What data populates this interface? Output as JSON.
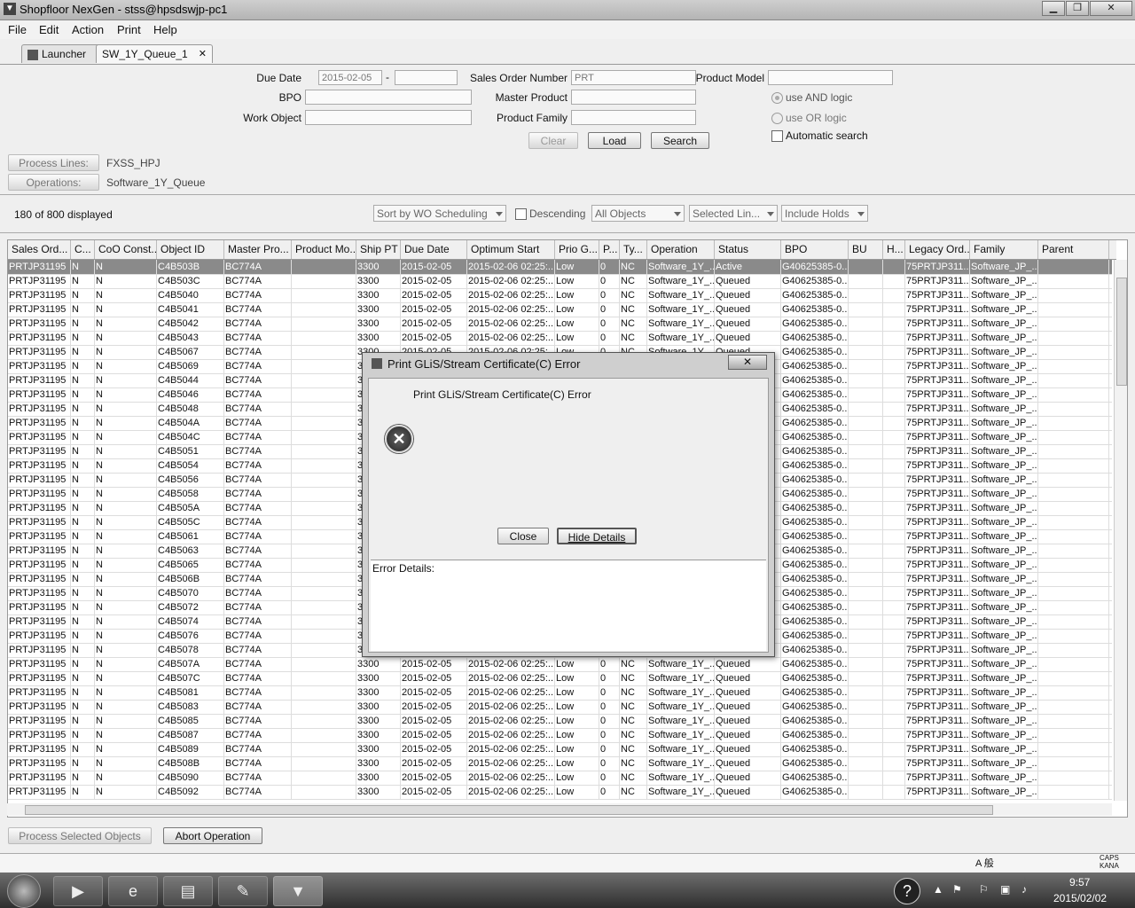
{
  "window": {
    "title": "Shopfloor NexGen - stss@hpsdswjp-pc1"
  },
  "menu": [
    "File",
    "Edit",
    "Action",
    "Print",
    "Help"
  ],
  "tabs": [
    {
      "label": "Launcher"
    },
    {
      "label": "SW_1Y_Queue_1",
      "close": "✕"
    }
  ],
  "search": {
    "due_date_label": "Due Date",
    "due_date_from": "2015-02-05",
    "due_date_sep": "-",
    "due_date_to": "",
    "bpo_label": "BPO",
    "bpo_value": "",
    "work_object_label": "Work Object",
    "work_object_value": "",
    "sales_order_label": "Sales Order Number",
    "sales_order_value": "PRT",
    "master_product_label": "Master Product",
    "master_product_value": "",
    "product_family_label": "Product Family",
    "product_family_value": "",
    "product_model_label": "Product Model",
    "product_model_value": "",
    "and_logic": "use AND logic",
    "or_logic": "use OR logic",
    "auto_search": "Automatic search",
    "clear": "Clear",
    "load": "Load",
    "search": "Search"
  },
  "process_lines": {
    "button": "Process Lines:",
    "value": "FXSS_HPJ"
  },
  "operations": {
    "button": "Operations:",
    "value": "Software_1Y_Queue"
  },
  "list_toolbar": {
    "count": "180 of 800 displayed",
    "sort": "Sort by WO Scheduling",
    "descending": "Descending",
    "objects": "All Objects",
    "lines": "Selected Lin...",
    "holds": "Include Holds"
  },
  "table": {
    "columns": [
      "Sales Ord...",
      "C...",
      "CoO Const...",
      "Object ID",
      "Master Pro...",
      "Product Mo...",
      "Ship PT",
      "Due Date",
      "Optimum Start",
      "Prio G...",
      "P...",
      "Ty...",
      "Operation",
      "Status",
      "BPO",
      "BU",
      "H...",
      "Legacy Ord...",
      "Family",
      "Parent"
    ],
    "common": {
      "sales_order": "PRTJP31195",
      "c": "N",
      "coo": "N",
      "master": "BC774A",
      "ship_pt": "3300",
      "due_date": "2015-02-05",
      "optimum": "2015-02-06 02:25:...",
      "prio": "Low",
      "p": "0",
      "type": "NC",
      "operation": "Software_1Y_...",
      "bpo": "G40625385-0...",
      "legacy": "75PRTJP311...",
      "family": "Software_JP_..."
    },
    "rows": [
      {
        "object_id": "C4B503B",
        "status": "Active"
      },
      {
        "object_id": "C4B503C",
        "status": "Queued"
      },
      {
        "object_id": "C4B5040",
        "status": "Queued"
      },
      {
        "object_id": "C4B5041",
        "status": "Queued"
      },
      {
        "object_id": "C4B5042",
        "status": "Queued"
      },
      {
        "object_id": "C4B5043",
        "status": "Queued"
      },
      {
        "object_id": "C4B5067",
        "status": "Queued"
      },
      {
        "object_id": "C4B5069",
        "status": "Queued"
      },
      {
        "object_id": "C4B5044",
        "status": "Queued"
      },
      {
        "object_id": "C4B5046",
        "status": "Queued"
      },
      {
        "object_id": "C4B5048",
        "status": "Queued"
      },
      {
        "object_id": "C4B504A",
        "status": "Queued"
      },
      {
        "object_id": "C4B504C",
        "status": "Queued"
      },
      {
        "object_id": "C4B5051",
        "status": "Queued"
      },
      {
        "object_id": "C4B5054",
        "status": "Queued"
      },
      {
        "object_id": "C4B5056",
        "status": "Queued"
      },
      {
        "object_id": "C4B5058",
        "status": "Queued"
      },
      {
        "object_id": "C4B505A",
        "status": "Queued"
      },
      {
        "object_id": "C4B505C",
        "status": "Queued"
      },
      {
        "object_id": "C4B5061",
        "status": "Queued"
      },
      {
        "object_id": "C4B5063",
        "status": "Queued"
      },
      {
        "object_id": "C4B5065",
        "status": "Queued"
      },
      {
        "object_id": "C4B506B",
        "status": "Queued"
      },
      {
        "object_id": "C4B5070",
        "status": "Queued"
      },
      {
        "object_id": "C4B5072",
        "status": "Queued"
      },
      {
        "object_id": "C4B5074",
        "status": "Queued"
      },
      {
        "object_id": "C4B5076",
        "status": "Queued"
      },
      {
        "object_id": "C4B5078",
        "status": "Queued"
      },
      {
        "object_id": "C4B507A",
        "status": "Queued"
      },
      {
        "object_id": "C4B507C",
        "status": "Queued"
      },
      {
        "object_id": "C4B5081",
        "status": "Queued"
      },
      {
        "object_id": "C4B5083",
        "status": "Queued"
      },
      {
        "object_id": "C4B5085",
        "status": "Queued"
      },
      {
        "object_id": "C4B5087",
        "status": "Queued"
      },
      {
        "object_id": "C4B5089",
        "status": "Queued"
      },
      {
        "object_id": "C4B508B",
        "status": "Queued"
      },
      {
        "object_id": "C4B5090",
        "status": "Queued"
      },
      {
        "object_id": "C4B5092",
        "status": "Queued"
      }
    ]
  },
  "bottom": {
    "process_selected": "Process Selected Objects",
    "abort": "Abort Operation"
  },
  "dialog": {
    "title": "Print GLiS/Stream Certificate(C) Error",
    "message": "Print GLiS/Stream Certificate(C) Error",
    "close": "Close",
    "hide_details": "Hide Details",
    "details_label": "Error Details:"
  },
  "tray": {
    "time": "9:57",
    "date": "2015/02/02",
    "ime": "A 般",
    "caps": "CAPS",
    "kana": "KANA"
  }
}
